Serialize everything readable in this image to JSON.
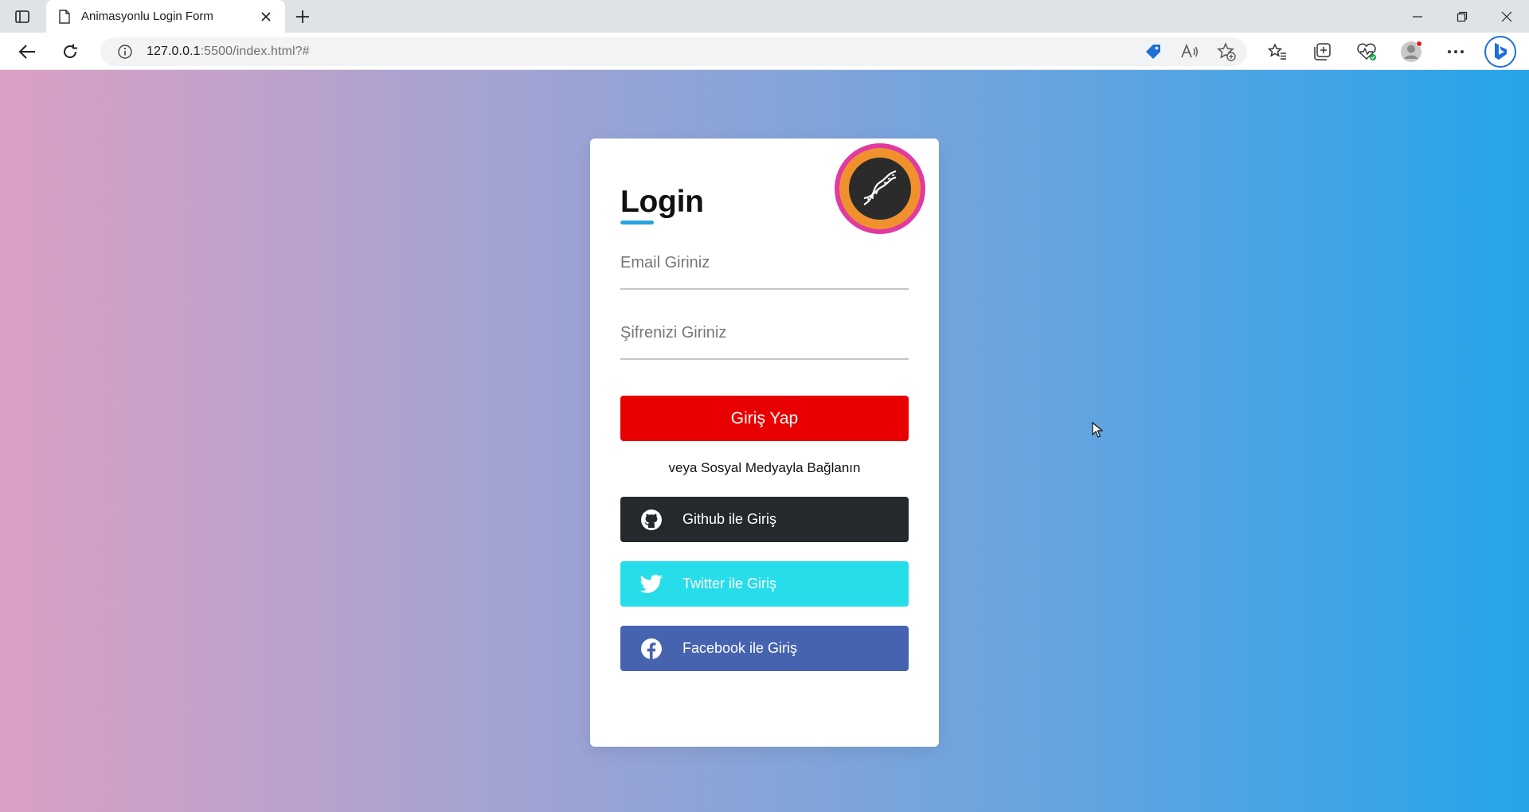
{
  "browser": {
    "tab_title": "Animasyonlu Login Form",
    "url_host": "127.0.0.1",
    "url_rest": ":5500/index.html?#",
    "address_icons": [
      "price-tag-icon",
      "read-aloud-icon",
      "add-favorite-icon"
    ],
    "toolbar_icons": [
      "favorites-icon",
      "collections-icon",
      "browser-essentials-icon",
      "profile-icon",
      "more-icon",
      "bing-chat-icon"
    ]
  },
  "login": {
    "title": "Login",
    "email_placeholder": "Email Giriniz",
    "password_placeholder": "Şifrenizi Giriniz",
    "submit_label": "Giriş Yap",
    "or_text": "veya Sosyal Medyayla Bağlanın",
    "github_label": "Github ile Giriş",
    "twitter_label": "Twitter ile Giriş",
    "facebook_label": "Facebook ile Giriş"
  },
  "colors": {
    "submit": "#e80000",
    "github": "#24292e",
    "twitter": "#27dde9",
    "facebook": "#4663b0",
    "accent": "#2aa3e0"
  }
}
